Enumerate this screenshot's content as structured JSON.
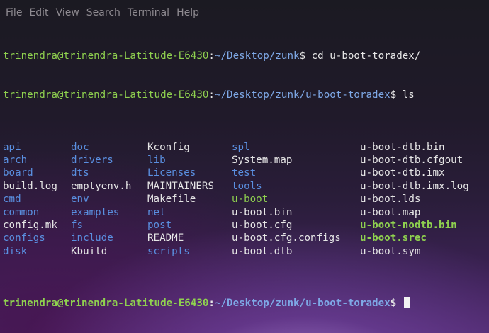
{
  "menubar": {
    "items": [
      "File",
      "Edit",
      "View",
      "Search",
      "Terminal",
      "Help"
    ]
  },
  "terminal": {
    "lines": [
      {
        "user": "trinendra@trinendra-Latitude-E6430",
        "sep": ":",
        "path": "~/Desktop/zunk",
        "cmd": "$ cd u-boot-toradex/"
      },
      {
        "user": "trinendra@trinendra-Latitude-E6430",
        "sep": ":",
        "path": "~/Desktop/zunk/u-boot-toradex",
        "cmd": "$ ls"
      }
    ],
    "ls_rows": [
      [
        {
          "name": "api",
          "type": "dir"
        },
        {
          "name": "doc",
          "type": "dir"
        },
        {
          "name": "Kconfig",
          "type": "file"
        },
        {
          "name": "spl",
          "type": "dir"
        },
        {
          "name": "u-boot-dtb.bin",
          "type": "file"
        }
      ],
      [
        {
          "name": "arch",
          "type": "dir"
        },
        {
          "name": "drivers",
          "type": "dir"
        },
        {
          "name": "lib",
          "type": "dir"
        },
        {
          "name": "System.map",
          "type": "file"
        },
        {
          "name": "u-boot-dtb.cfgout",
          "type": "file"
        }
      ],
      [
        {
          "name": "board",
          "type": "dir"
        },
        {
          "name": "dts",
          "type": "dir"
        },
        {
          "name": "Licenses",
          "type": "dir"
        },
        {
          "name": "test",
          "type": "dir"
        },
        {
          "name": "u-boot-dtb.imx",
          "type": "file"
        }
      ],
      [
        {
          "name": "build.log",
          "type": "file"
        },
        {
          "name": "emptyenv.h",
          "type": "file"
        },
        {
          "name": "MAINTAINERS",
          "type": "file"
        },
        {
          "name": "tools",
          "type": "dir"
        },
        {
          "name": "u-boot-dtb.imx.log",
          "type": "file"
        }
      ],
      [
        {
          "name": "cmd",
          "type": "dir"
        },
        {
          "name": "env",
          "type": "dir"
        },
        {
          "name": "Makefile",
          "type": "file"
        },
        {
          "name": "u-boot",
          "type": "exec-plain"
        },
        {
          "name": "u-boot.lds",
          "type": "file"
        }
      ],
      [
        {
          "name": "common",
          "type": "dir"
        },
        {
          "name": "examples",
          "type": "dir"
        },
        {
          "name": "net",
          "type": "dir"
        },
        {
          "name": "u-boot.bin",
          "type": "file"
        },
        {
          "name": "u-boot.map",
          "type": "file"
        }
      ],
      [
        {
          "name": "config.mk",
          "type": "file"
        },
        {
          "name": "fs",
          "type": "dir"
        },
        {
          "name": "post",
          "type": "dir"
        },
        {
          "name": "u-boot.cfg",
          "type": "file"
        },
        {
          "name": "u-boot-nodtb.bin",
          "type": "exec"
        }
      ],
      [
        {
          "name": "configs",
          "type": "dir"
        },
        {
          "name": "include",
          "type": "dir"
        },
        {
          "name": "README",
          "type": "file"
        },
        {
          "name": "u-boot.cfg.configs",
          "type": "file"
        },
        {
          "name": "u-boot.srec",
          "type": "exec"
        }
      ],
      [
        {
          "name": "disk",
          "type": "dir"
        },
        {
          "name": "Kbuild",
          "type": "file"
        },
        {
          "name": "scripts",
          "type": "dir"
        },
        {
          "name": "u-boot.dtb",
          "type": "file"
        },
        {
          "name": "u-boot.sym",
          "type": "file"
        }
      ]
    ],
    "final_prompt": {
      "user": "trinendra@trinendra-Latitude-E6430",
      "sep": ":",
      "path": "~/Desktop/zunk/u-boot-toradex",
      "cmd": "$ "
    }
  },
  "colors": {
    "prompt_user": "#8fd14f",
    "prompt_path": "#7ea8e6",
    "directory": "#5a8fe0",
    "executable": "#8fd14f",
    "file": "#e6e6e6"
  }
}
